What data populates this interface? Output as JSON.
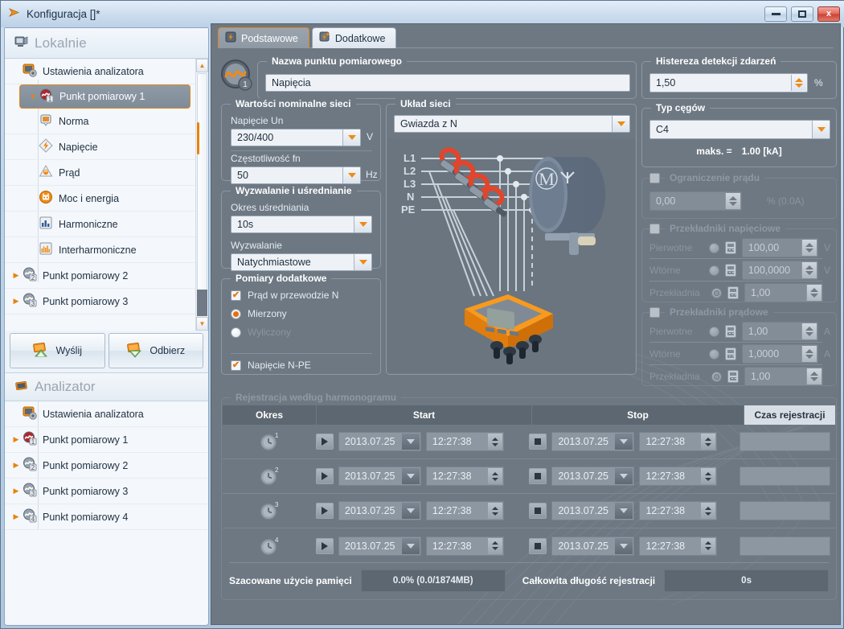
{
  "window": {
    "title": "Konfiguracja []*",
    "icon": "app-logo-icon",
    "minimize_label": "minimize",
    "maximize_label": "maximize",
    "close_label": "x"
  },
  "sidebar": {
    "local_header": "Lokalnie",
    "analyzer_header": "Analizator",
    "local_items": [
      {
        "label": "Ustawienia analizatora",
        "icon": "analyzer-settings-icon",
        "twisty": "",
        "level": "child2",
        "selected": false
      },
      {
        "label": "Punkt pomiarowy 1",
        "icon": "measurement-point-1-icon",
        "twisty": "▼",
        "level": "top",
        "selected": true
      },
      {
        "label": "Norma",
        "icon": "norm-icon",
        "twisty": "",
        "level": "child",
        "selected": false
      },
      {
        "label": "Napięcie",
        "icon": "voltage-icon",
        "twisty": "",
        "level": "child",
        "selected": false
      },
      {
        "label": "Prąd",
        "icon": "current-icon",
        "twisty": "",
        "level": "child",
        "selected": false
      },
      {
        "label": "Moc i energia",
        "icon": "power-energy-icon",
        "twisty": "",
        "level": "child",
        "selected": false
      },
      {
        "label": "Harmoniczne",
        "icon": "harmonics-icon",
        "twisty": "",
        "level": "child",
        "selected": false
      },
      {
        "label": "Interharmoniczne",
        "icon": "interharmonics-icon",
        "twisty": "",
        "level": "child",
        "selected": false
      },
      {
        "label": "Punkt pomiarowy 2",
        "icon": "measurement-point-2-icon",
        "twisty": "▶",
        "level": "top",
        "selected": false
      },
      {
        "label": "Punkt pomiarowy 3",
        "icon": "measurement-point-3-icon",
        "twisty": "▶",
        "level": "top",
        "selected": false
      }
    ],
    "buttons": [
      {
        "label": "Wyślij",
        "icon": "send-icon"
      },
      {
        "label": "Odbierz",
        "icon": "receive-icon"
      }
    ],
    "analyzer_items": [
      {
        "label": "Ustawienia analizatora",
        "icon": "analyzer-settings-icon",
        "twisty": ""
      },
      {
        "label": "Punkt pomiarowy 1",
        "icon": "measurement-point-1-icon",
        "twisty": "▶"
      },
      {
        "label": "Punkt pomiarowy 2",
        "icon": "measurement-point-2-icon",
        "twisty": "▶"
      },
      {
        "label": "Punkt pomiarowy 3",
        "icon": "measurement-point-3-icon",
        "twisty": "▶"
      },
      {
        "label": "Punkt pomiarowy 4",
        "icon": "measurement-point-4-icon",
        "twisty": "▶"
      }
    ]
  },
  "tabs": [
    {
      "label": "Podstawowe",
      "icon": "lightning-icon",
      "active": true
    },
    {
      "label": "Dodatkowe",
      "icon": "lightning-plus-icon",
      "active": false
    }
  ],
  "name_group": {
    "title": "Nazwa punktu pomiarowego",
    "value": "Napięcia",
    "icon": "waveform-icon"
  },
  "nominal_group": {
    "title": "Wartości nominalne sieci",
    "voltage_label": "Napięcie Un",
    "voltage_value": "230/400",
    "voltage_unit": "V",
    "freq_label": "Częstotliwość fn",
    "freq_value": "50",
    "freq_unit": "Hz"
  },
  "trigger_group": {
    "title": "Wyzwalanie i uśrednianie",
    "avg_label": "Okres uśredniania",
    "avg_value": "10s",
    "trig_label": "Wyzwalanie",
    "trig_value": "Natychmiastowe"
  },
  "extra_group": {
    "title": "Pomiary dodatkowe",
    "items": [
      {
        "label": "Prąd w przewodzie N",
        "type": "checkbox",
        "checked": true
      },
      {
        "label": "Mierzony",
        "type": "radio",
        "checked": true
      },
      {
        "label": "Wyliczony",
        "type": "radio",
        "checked": false
      }
    ],
    "npe_label": "Napięcie N-PE",
    "npe_checked": true
  },
  "network_group": {
    "title": "Układ sieci",
    "value": "Gwiazda z N",
    "phase_labels": [
      "L1",
      "L2",
      "L3",
      "N",
      "PE"
    ],
    "motor_label": "M",
    "device_icon": "analyzer-device-icon"
  },
  "hysteresis_group": {
    "title": "Histereza detekcji zdarzeń",
    "value": "1,50",
    "unit": "%"
  },
  "clamp_group": {
    "title": "Typ cęgów",
    "value": "C4",
    "max_label": "maks. =",
    "max_value": "1.00 [kA]"
  },
  "limit_group": {
    "title": "Ograniczenie prądu",
    "checked": false,
    "value": "0,00",
    "unit": "% (0.0A)"
  },
  "voltage_transformers": {
    "title": "Przekładniki napięciowe",
    "checked": false,
    "rows": [
      {
        "label": "Pierwotne",
        "radio": false,
        "value": "100,00",
        "unit": "V"
      },
      {
        "label": "Wtórne",
        "radio": false,
        "value": "100,0000",
        "unit": "V"
      },
      {
        "label": "Przekładnia",
        "radio": true,
        "value": "1,00",
        "unit": ""
      }
    ]
  },
  "current_transformers": {
    "title": "Przekładniki prądowe",
    "checked": false,
    "rows": [
      {
        "label": "Pierwotne",
        "radio": false,
        "value": "1,00",
        "unit": "A"
      },
      {
        "label": "Wtórne",
        "radio": false,
        "value": "1,0000",
        "unit": "A"
      },
      {
        "label": "Przekładnia",
        "radio": true,
        "value": "1,00",
        "unit": ""
      }
    ]
  },
  "schedule": {
    "title": "Rejestracja według harmonogramu",
    "columns": [
      "Okres",
      "Start",
      "Stop",
      "Czas rejestracji"
    ],
    "rows": [
      {
        "period": "1",
        "start_date": "2013.07.25",
        "start_time": "12:27:38",
        "stop_date": "2013.07.25",
        "stop_time": "12:27:38",
        "duration": ""
      },
      {
        "period": "2",
        "start_date": "2013.07.25",
        "start_time": "12:27:38",
        "stop_date": "2013.07.25",
        "stop_time": "12:27:38",
        "duration": ""
      },
      {
        "period": "3",
        "start_date": "2013.07.25",
        "start_time": "12:27:38",
        "stop_date": "2013.07.25",
        "stop_time": "12:27:38",
        "duration": ""
      },
      {
        "period": "4",
        "start_date": "2013.07.25",
        "start_time": "12:27:38",
        "stop_date": "2013.07.25",
        "stop_time": "12:27:38",
        "duration": ""
      }
    ],
    "memory_label": "Szacowane użycie pamięci",
    "memory_value": "0.0% (0.0/1874MB)",
    "duration_label": "Całkowita długość rejestracji",
    "duration_value": "0s"
  },
  "colors": {
    "accent_orange": "#e8820c",
    "panel_dark": "#6d7883",
    "titlebar": "#cbdcee",
    "close_red": "#cc4233"
  }
}
